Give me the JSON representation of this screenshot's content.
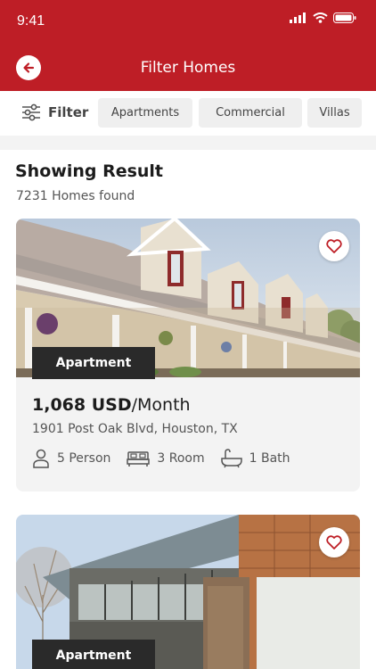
{
  "status": {
    "time": "9:41"
  },
  "nav": {
    "title": "Filter Homes"
  },
  "filters": {
    "label": "Filter",
    "chips": [
      "Apartments",
      "Commercial",
      "Villas"
    ]
  },
  "results": {
    "title": "Showing Result",
    "count_text": "7231 Homes found"
  },
  "listings": [
    {
      "type": "Apartment",
      "price": "1,068 USD",
      "period": "/Month",
      "address": "1901 Post Oak Blvd, Houston, TX",
      "persons": "5 Person",
      "rooms": "3 Room",
      "baths": "1 Bath"
    },
    {
      "type": "Apartment"
    }
  ],
  "colors": {
    "brand": "#be1e26",
    "card": "#f3f3f3",
    "tag": "#2a2a2a"
  },
  "icons": [
    "back-arrow-icon",
    "filter-sliders-icon",
    "heart-icon",
    "person-icon",
    "bed-icon",
    "bath-icon"
  ]
}
